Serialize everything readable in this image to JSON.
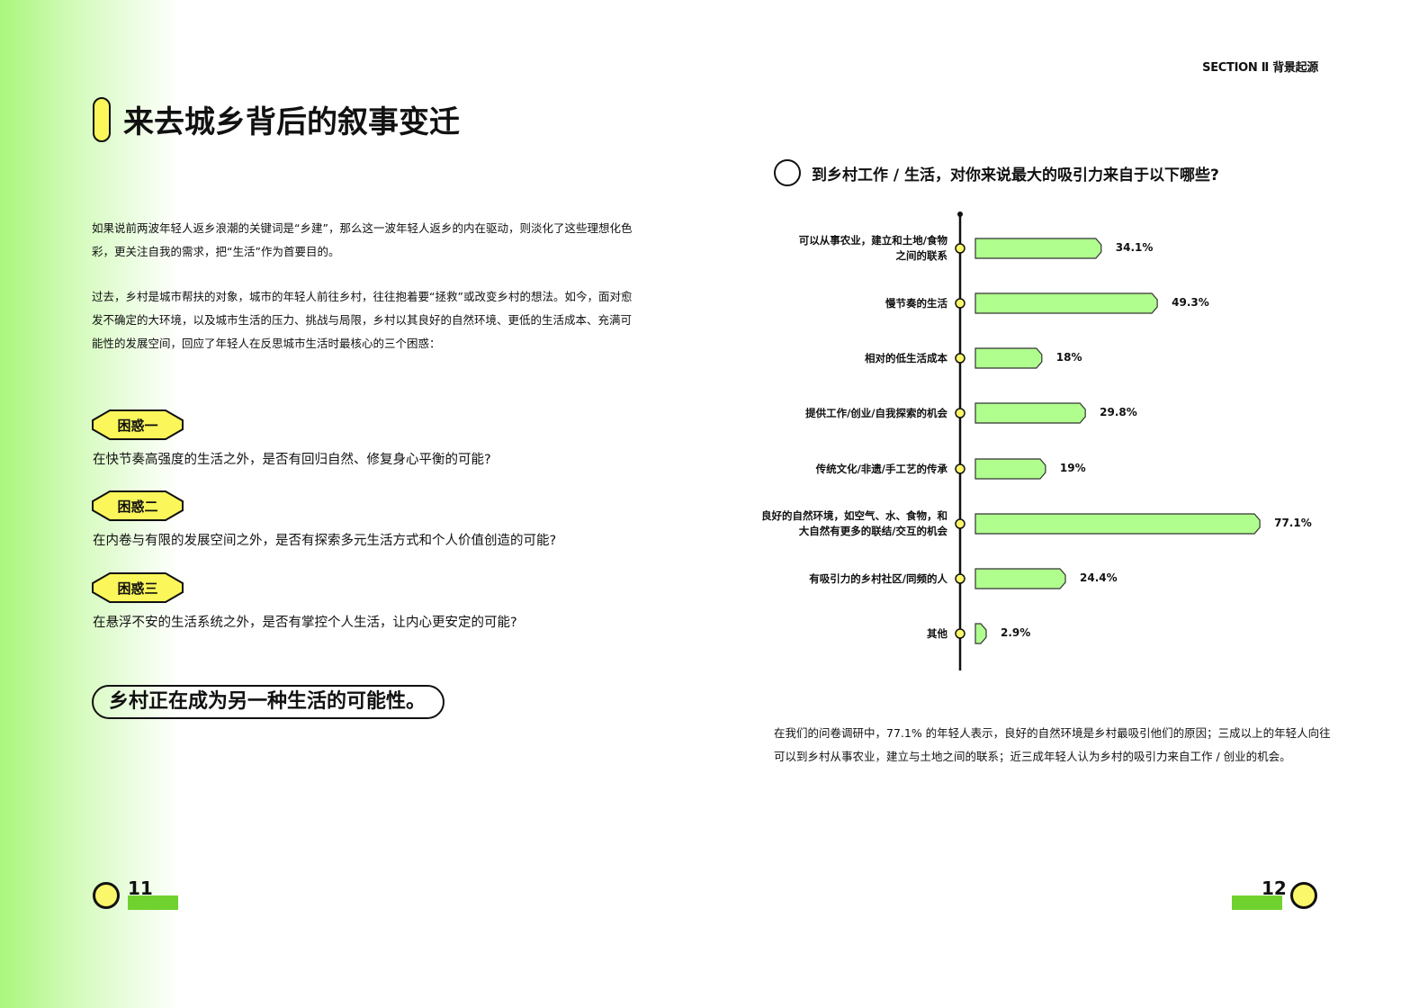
{
  "header": {
    "section": "SECTION Ⅱ 背景起源"
  },
  "left": {
    "title": "来去城乡背后的叙事变迁",
    "paragraphs": [
      "如果说前两波年轻人返乡浪潮的关键词是“乡建”，那么这一波年轻人返乡的内在驱动，则淡化了这些理想化色彩，更关注自我的需求，把“生活”作为首要目的。",
      "过去，乡村是城市帮扶的对象，城市的年轻人前往乡村，往往抱着要“拯救”或改变乡村的想法。如今，面对愈发不确定的大环境，以及城市生活的压力、挑战与局限，乡村以其良好的自然环境、更低的生活成本、充满可能性的发展空间，回应了年轻人在反思城市生活时最核心的三个困惑："
    ],
    "puzzles": [
      {
        "badge": "困惑一",
        "text": "在快节奏高强度的生活之外，是否有回归自然、修复身心平衡的可能?"
      },
      {
        "badge": "困惑二",
        "text": "在内卷与有限的发展空间之外，是否有探索多元生活方式和个人价值创造的可能?"
      },
      {
        "badge": "困惑三",
        "text": "在悬浮不安的生活系统之外，是否有掌控个人生活，让内心更安定的可能?"
      }
    ],
    "slogan": "乡村正在成为另一种生活的可能性。",
    "page": "11"
  },
  "right": {
    "note": "在我们的问卷调研中，77.1% 的年轻人表示，良好的自然环境是乡村最吸引他们的原因；三成以上的年轻人向往可以到乡村从事农业，建立与土地之间的联系；近三成年轻人认为乡村的吸引力来自工作 / 创业的机会。",
    "page": "12"
  },
  "chart_data": {
    "type": "bar",
    "orientation": "horizontal",
    "title": "到乡村工作 / 生活，对你来说最大的吸引力来自于以下哪些?",
    "categories": [
      "可以从事农业，建立和土地/食物之间的联系",
      "慢节奏的生活",
      "相对的低生活成本",
      "提供工作/创业/自我探索的机会",
      "传统文化/非遗/手工艺的传承",
      "良好的自然环境，如空气、水、食物，和大自然有更多的联结/交互的机会",
      "有吸引力的乡村社区/同频的人",
      "其他"
    ],
    "label_lines": [
      [
        "可以从事农业，建立和土地/食物",
        "之间的联系"
      ],
      [
        "慢节奏的生活"
      ],
      [
        "相对的低生活成本"
      ],
      [
        "提供工作/创业/自我探索的机会"
      ],
      [
        "传统文化/非遗/手工艺的传承"
      ],
      [
        "良好的自然环境，如空气、水、食物，和",
        "大自然有更多的联结/交互的机会"
      ],
      [
        "有吸引力的乡村社区/同频的人"
      ],
      [
        "其他"
      ]
    ],
    "values": [
      34.1,
      49.3,
      18,
      29.8,
      19,
      77.1,
      24.4,
      2.9
    ],
    "value_labels": [
      "34.1%",
      "49.3%",
      "18%",
      "29.8%",
      "19%",
      "77.1%",
      "24.4%",
      "2.9%"
    ],
    "unit": "%",
    "colors": {
      "bar": "#b0ff8e",
      "dot": "#fbf76b"
    }
  }
}
